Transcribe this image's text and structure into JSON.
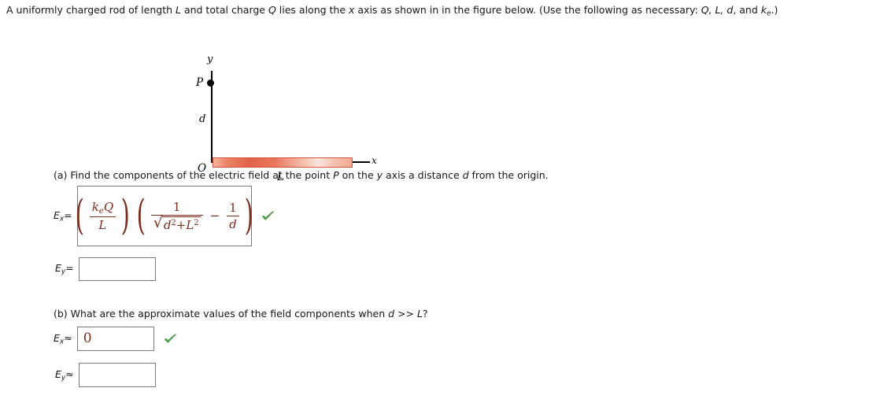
{
  "problem": {
    "statement_parts": [
      "A uniformly charged rod of length ",
      "L",
      " and total charge ",
      "Q",
      " lies along the ",
      "x",
      " axis as shown in in the figure below. (Use the following as necessary: ",
      "Q, L, d",
      ", and ",
      "k",
      "e",
      ".)"
    ],
    "statement_plain": "A uniformly charged rod of length L and total charge Q lies along the x axis as shown in in the figure below. (Use the following as necessary: Q, L, d, and ke.)"
  },
  "figure": {
    "y_axis_label": "y",
    "x_axis_label": "x",
    "point_label": "P",
    "origin_label": "O",
    "distance_label": "d",
    "length_label": "L",
    "rod_color_light": "#f6b6a2",
    "rod_color_dark": "#e2614a",
    "rod_border_color": "#d9543a",
    "axis_color": "#000000"
  },
  "parts": {
    "a": {
      "prompt_plain": "(a) Find the components of the electric field at the point P on the y axis a distance d from the origin.",
      "prompt_pieces": {
        "p1": "(a) Find the components of the electric field at the point ",
        "v1": "P",
        "p2": " on the ",
        "v2": "y",
        "p3": " axis a distance ",
        "v3": "d",
        "p4": " from the origin."
      },
      "ex": {
        "label_var": "E",
        "label_sub": "x",
        "relation": "=",
        "value_plain": "(keQ/L)(1/sqrt(d^2+L^2) - 1/d)",
        "tokens": {
          "k": "k",
          "k_sub": "e",
          "Q": "Q",
          "L_den": "L",
          "one_a": "1",
          "radicand_d": "d",
          "radicand_d_exp": "2",
          "radicand_plus": "+",
          "radicand_L": "L",
          "radicand_L_exp": "2",
          "minus": "−",
          "one_b": "1",
          "d_den": "d"
        },
        "status": "correct",
        "status_icon": "green-check-icon"
      },
      "ey": {
        "label_var": "E",
        "label_sub": "y",
        "relation": "=",
        "value": "",
        "placeholder": ""
      }
    },
    "b": {
      "prompt_plain": "(b) What are the approximate values of the field components when d >> L?",
      "prompt_pieces": {
        "p1": "(b) What are the approximate values of the field components when ",
        "v1": "d",
        "p2": " >> ",
        "v2": "L",
        "p3": "?"
      },
      "ex": {
        "label_var": "E",
        "label_sub": "x",
        "relation": "≈",
        "value": "0",
        "status": "correct",
        "status_icon": "green-check-icon"
      },
      "ey": {
        "label_var": "E",
        "label_sub": "y",
        "relation": "≈",
        "value": "",
        "placeholder": ""
      }
    }
  },
  "colors": {
    "answer_text": "#7c2d1c",
    "box_border": "#7a7a7a",
    "check_green": "#4ea84e",
    "body_text": "#161616"
  }
}
